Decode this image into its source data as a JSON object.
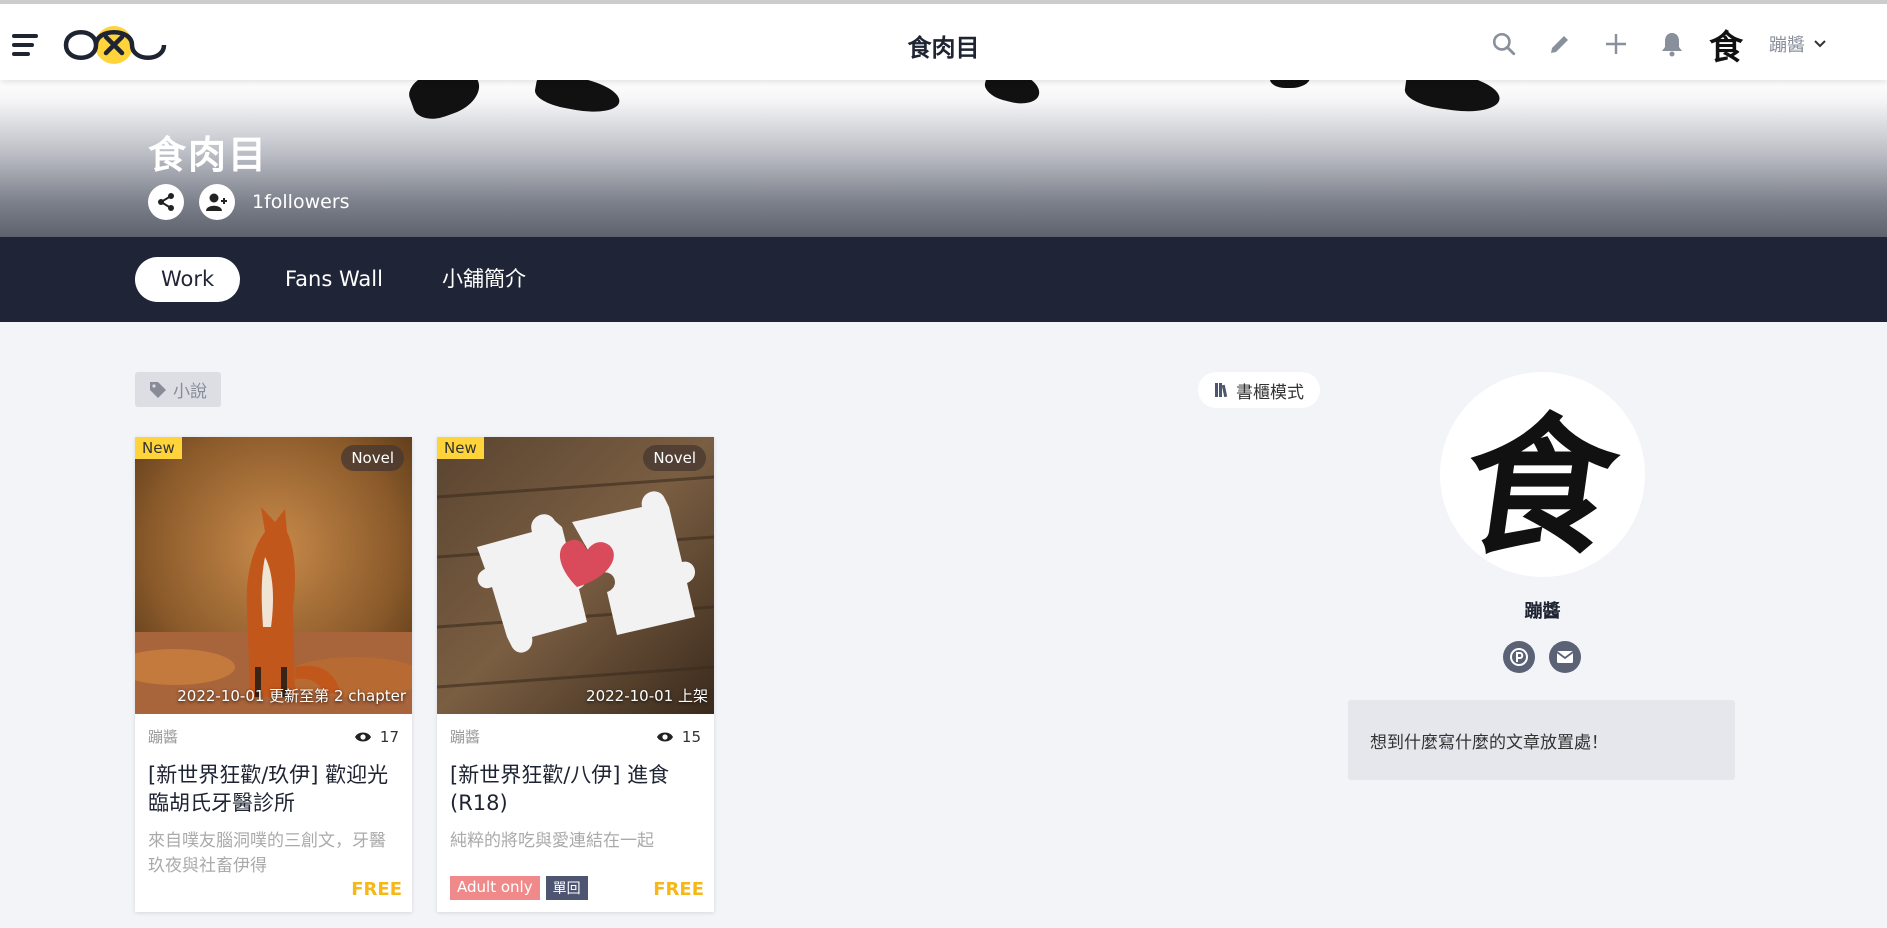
{
  "header": {
    "title": "食肉目",
    "avatar_char": "食",
    "username": "蹦醬"
  },
  "shop": {
    "title": "食肉目",
    "followers": "1followers"
  },
  "tabs": [
    {
      "label": "Work",
      "active": true
    },
    {
      "label": "Fans Wall",
      "active": false
    },
    {
      "label": "小舖簡介",
      "active": false
    }
  ],
  "filter": {
    "tag": "小說",
    "shelf_mode": "書櫃模式"
  },
  "works": [
    {
      "badge_new": "New",
      "badge_type": "Novel",
      "caption": "2022-10-01 更新至第 2 chapter",
      "author": "蹦醬",
      "views": "17",
      "title": "[新世界狂歡/玖伊] 歡迎光臨胡氏牙醫診所",
      "description": "來自噗友腦洞噗的三創文，牙醫玖夜與社畜伊得",
      "price": "FREE",
      "tags": []
    },
    {
      "badge_new": "New",
      "badge_type": "Novel",
      "caption": "2022-10-01 上架",
      "author": "蹦醬",
      "views": "15",
      "title": "[新世界狂歡/八伊] 進食(R18)",
      "description": "純粹的將吃與愛連結在一起",
      "price": "FREE",
      "tags": [
        "Adult only",
        "單回"
      ]
    }
  ],
  "profile": {
    "avatar_char": "食",
    "name": "蹦醬",
    "bio": "想到什麼寫什麼的文章放置處！"
  },
  "colors": {
    "accent": "#f5b817",
    "nav_bg": "#1f2436",
    "new_badge": "#ffd43b",
    "adult_tag": "#f08a8a"
  }
}
